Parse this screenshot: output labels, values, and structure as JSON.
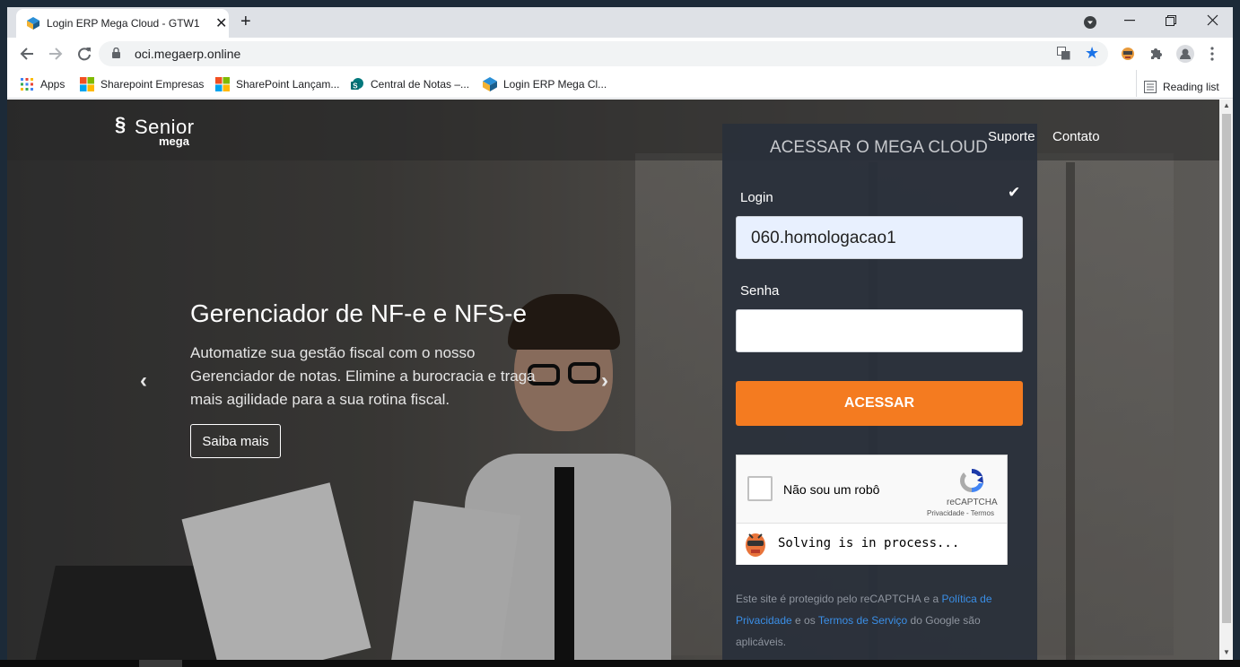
{
  "browser": {
    "tab_title": "Login ERP Mega Cloud - GTW1",
    "tab_close": "✕",
    "new_tab": "+",
    "url": "oci.megaerp.online",
    "bookmarks": [
      {
        "label": "Apps"
      },
      {
        "label": "Sharepoint Empresas"
      },
      {
        "label": "SharePoint Lançam..."
      },
      {
        "label": "Central de Notas –..."
      },
      {
        "label": "Login ERP Mega Cl..."
      }
    ],
    "reading_list": "Reading list"
  },
  "site": {
    "logo_brand": "Senior",
    "logo_sub": "mega",
    "nav": {
      "support": "Suporte",
      "contact": "Contato"
    },
    "hero": {
      "title": "Gerenciador de NF-e e NFS-e",
      "text": "Automatize sua gestão fiscal com o nosso Gerenciador de notas. Elimine a burocracia e traga mais agilidade para a sua rotina fiscal.",
      "button": "Saiba mais"
    }
  },
  "login": {
    "title": "ACESSAR O MEGA CLOUD",
    "login_label": "Login",
    "login_value": "060.homologacao1",
    "password_label": "Senha",
    "submit": "ACESSAR",
    "captcha": {
      "label": "Não sou um robô",
      "brand": "reCAPTCHA",
      "links": "Privacidade - Termos",
      "solver_status": "Solving is in process..."
    },
    "legal": {
      "p1": "Este site é protegido pelo reCAPTCHA e a ",
      "link1": "Política de Privacidade",
      "p2": " e os ",
      "link2": "Termos de Serviço",
      "p3": " do Google são aplicáveis."
    }
  },
  "colors": {
    "accent": "#f47b20",
    "panel": "#292f3a",
    "link": "#3a8ee6"
  }
}
